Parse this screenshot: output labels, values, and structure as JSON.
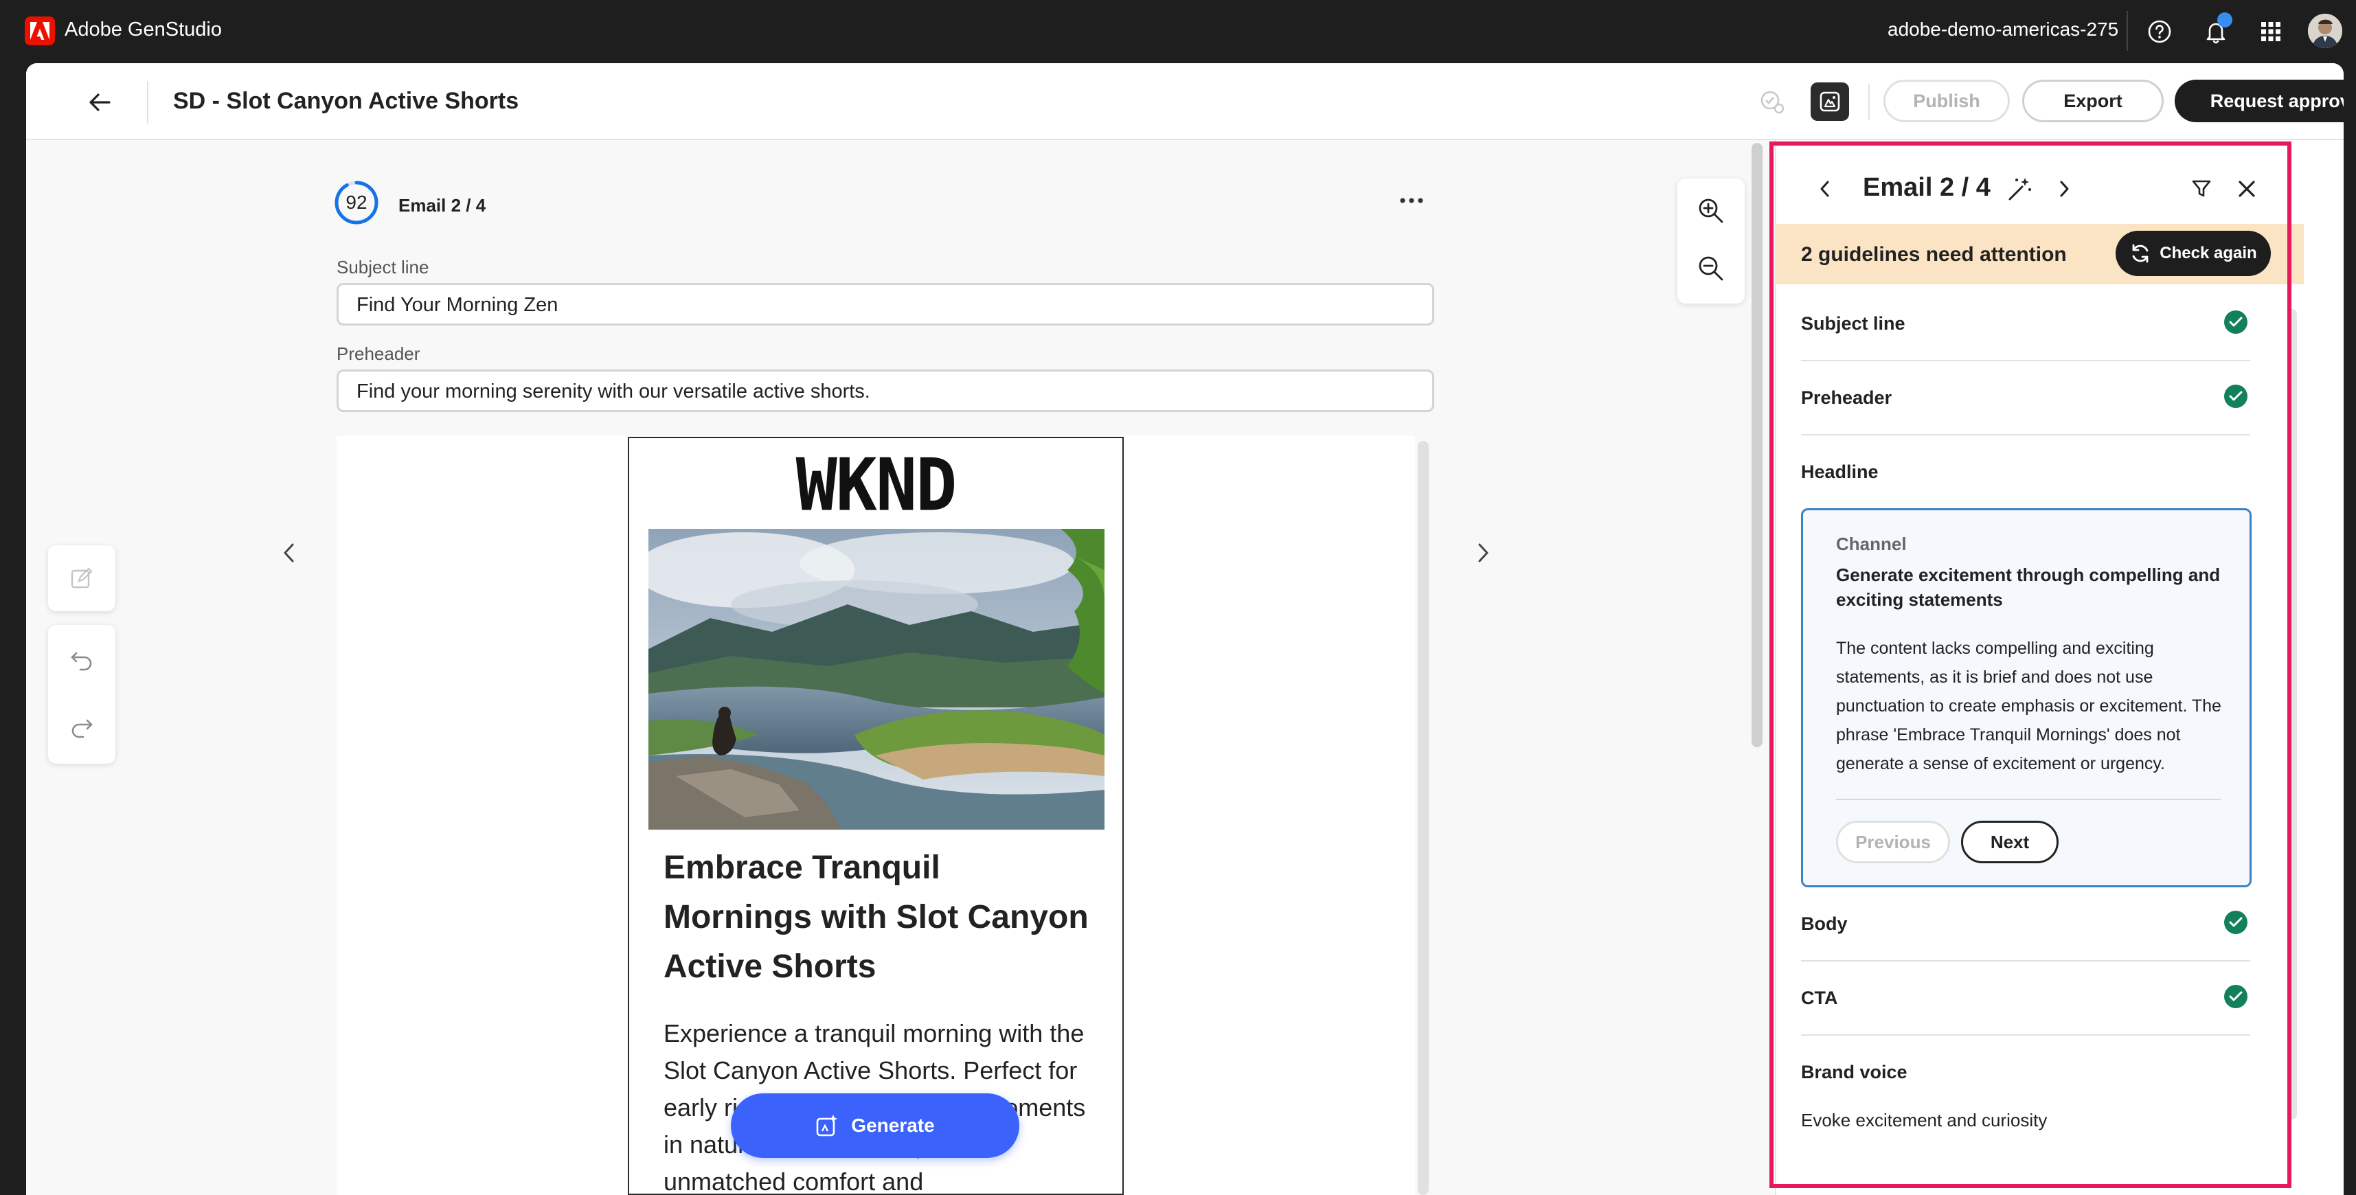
{
  "topbar": {
    "app_name": "Adobe GenStudio",
    "org_name": "adobe-demo-americas-275"
  },
  "header": {
    "title": "SD - Slot Canyon Active Shorts",
    "publish_label": "Publish",
    "export_label": "Export",
    "request_label": "Request approval"
  },
  "editor": {
    "score": "92",
    "email_index": "Email 2 / 4",
    "subject_label": "Subject line",
    "subject_value": "Find Your Morning Zen",
    "preheader_label": "Preheader",
    "preheader_value": "Find your morning serenity with our versatile active shorts."
  },
  "email": {
    "logo": "WKND",
    "headline": "Embrace Tranquil Mornings with Slot Canyon Active Shorts",
    "body": "Experience a tranquil morning with the Slot Canyon Active Shorts. Perfect for early risers seeking peaceful moments in nature, these shorts provide unmatched comfort and"
  },
  "generate_label": "Generate",
  "panel": {
    "title": "Email 2 / 4",
    "attention": "2 guidelines need attention",
    "check_again": "Check again",
    "rows": [
      {
        "label": "Subject line"
      },
      {
        "label": "Preheader"
      },
      {
        "label": "Headline"
      },
      {
        "label": "Body"
      },
      {
        "label": "CTA"
      },
      {
        "label": "Brand voice"
      }
    ],
    "card": {
      "category": "Channel",
      "title": "Generate excitement through compelling and exciting statements",
      "body": "The content lacks compelling and exciting statements, as it is brief and does not use punctuation to create emphasis or excitement. The phrase 'Embrace Tranquil Mornings' does not generate a sense of excitement or urgency.",
      "previous": "Previous",
      "next": "Next"
    },
    "brand_voice_sub": "Evoke excitement and curiosity"
  },
  "colors": {
    "accent": "#3b63fb",
    "highlight": "#e8195b",
    "success": "#12805c",
    "attention_bg": "#fbe4c3"
  }
}
